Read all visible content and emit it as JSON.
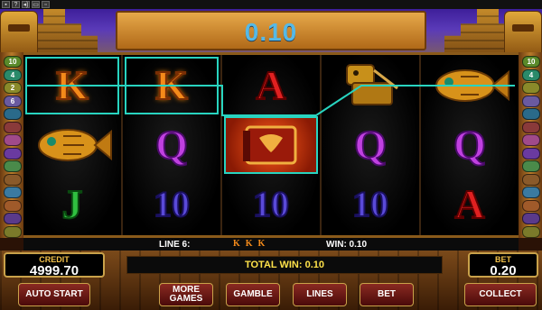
{
  "toolbar": {
    "items": [
      {
        "name": "flag-icon",
        "glyph": "▪"
      },
      {
        "name": "help-button",
        "glyph": "?"
      },
      {
        "name": "sound-icon",
        "glyph": "◂)"
      },
      {
        "name": "fullscreen-button",
        "glyph": "▭"
      },
      {
        "name": "settings-button",
        "glyph": "▫"
      }
    ]
  },
  "bet_display": {
    "value": "0.10"
  },
  "reels": [
    [
      "K",
      "fish",
      "J"
    ],
    [
      "K",
      "Q",
      "10"
    ],
    [
      "A",
      "book",
      "10"
    ],
    [
      "idol",
      "Q",
      "10"
    ],
    [
      "fish",
      "Q",
      "A"
    ]
  ],
  "line_markers": {
    "left": [
      {
        "label": "10",
        "color": "#5a8a2a"
      },
      {
        "label": "4",
        "color": "#2a8a6a"
      },
      {
        "label": "2",
        "color": "#8a8a2a"
      },
      {
        "label": "6",
        "color": "#6a5aa0"
      },
      {
        "label": "",
        "color": "#2a6a8a"
      },
      {
        "label": "",
        "color": "#8a3a3a"
      },
      {
        "label": "",
        "color": "#a04a8a"
      },
      {
        "label": "",
        "color": "#6a3aa0"
      },
      {
        "label": "",
        "color": "#4a8a4a"
      },
      {
        "label": "",
        "color": "#8a5a2a"
      },
      {
        "label": "",
        "color": "#3a7aa0"
      },
      {
        "label": "",
        "color": "#a05a2a"
      },
      {
        "label": "",
        "color": "#5a3a8a"
      },
      {
        "label": "",
        "color": "#7a7a2a"
      }
    ],
    "right": [
      {
        "label": "10",
        "color": "#5a8a2a"
      },
      {
        "label": "4",
        "color": "#2a8a6a"
      },
      {
        "label": "",
        "color": "#8a8a2a"
      },
      {
        "label": "",
        "color": "#6a5aa0"
      },
      {
        "label": "",
        "color": "#2a6a8a"
      },
      {
        "label": "",
        "color": "#8a3a3a"
      },
      {
        "label": "",
        "color": "#a04a8a"
      },
      {
        "label": "",
        "color": "#6a3aa0"
      },
      {
        "label": "",
        "color": "#4a8a4a"
      },
      {
        "label": "",
        "color": "#8a5a2a"
      },
      {
        "label": "",
        "color": "#3a7aa0"
      },
      {
        "label": "",
        "color": "#a05a2a"
      },
      {
        "label": "",
        "color": "#5a3a8a"
      },
      {
        "label": "",
        "color": "#7a7a2a"
      }
    ]
  },
  "win_info": {
    "line_label": "LINE 6:",
    "symbols": "KKK",
    "win_label": "WIN: 0.10"
  },
  "credit": {
    "label": "CREDIT",
    "value": "4999.70"
  },
  "total_win": {
    "text": "TOTAL WIN: 0.10"
  },
  "bet": {
    "label": "BET",
    "value": "0.20"
  },
  "buttons": {
    "auto_start": "AUTO START",
    "more_games": "MORE GAMES",
    "gamble": "GAMBLE",
    "lines": "LINES",
    "bet": "BET",
    "collect": "COLLECT"
  },
  "colors": {
    "accent_bet": "#56b9e6",
    "payline": "#28d4c0",
    "total_win_text": "#ffe24a",
    "label_gold": "#f2c14a"
  }
}
